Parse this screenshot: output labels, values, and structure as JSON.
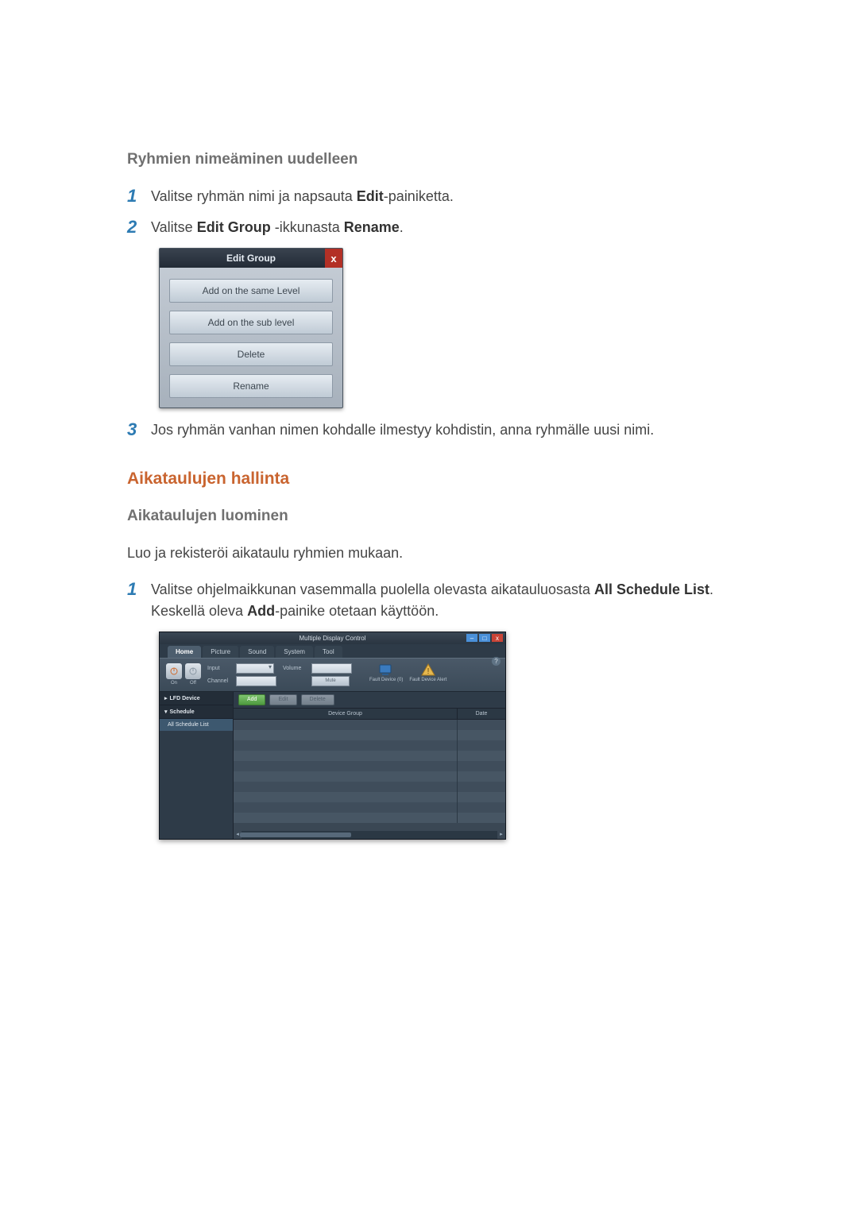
{
  "sec1": {
    "heading": "Ryhmien nimeäminen uudelleen",
    "step1_pre": "Valitse ryhmän nimi ja napsauta ",
    "step1_b": "Edit",
    "step1_post": "-painiketta.",
    "step2_pre": "Valitse ",
    "step2_b1": "Edit Group",
    "step2_mid": " -ikkunasta ",
    "step2_b2": "Rename",
    "step2_post": ".",
    "step3": "Jos ryhmän vanhan nimen kohdalle ilmestyy kohdistin, anna ryhmälle uusi nimi."
  },
  "dialog": {
    "title": "Edit Group",
    "close": "x",
    "btn1": "Add on the same Level",
    "btn2": "Add on the sub level",
    "btn3": "Delete",
    "btn4": "Rename"
  },
  "sec2": {
    "heading": "Aikataulujen hallinta",
    "sub": "Aikataulujen luominen",
    "intro": "Luo ja rekisteröi aikataulu ryhmien mukaan.",
    "step1_pre": "Valitse ohjelmaikkunan vasemmalla puolella olevasta aikatauluosasta ",
    "step1_b1": "All Schedule List",
    "step1_mid": ". Keskellä oleva ",
    "step1_b2": "Add",
    "step1_post": "-painike otetaan käyttöön."
  },
  "mdc": {
    "title": "Multiple Display Control",
    "tabs": {
      "home": "Home",
      "picture": "Picture",
      "sound": "Sound",
      "system": "System",
      "tool": "Tool"
    },
    "ribbon": {
      "on": "On",
      "off": "Off",
      "input": "Input",
      "channel": "Channel",
      "volume": "Volume",
      "mute": "Mute",
      "fault0": "Fault Device (0)",
      "alert": "Fault Device Alert"
    },
    "toolbar": {
      "add": "Add",
      "edit": "Edit",
      "delete": "Delete"
    },
    "side": {
      "lfd": "LFD Device",
      "schedule": "Schedule",
      "all": "All Schedule List"
    },
    "grid": {
      "group": "Device Group",
      "date": "Date"
    },
    "help": "?",
    "close": "x",
    "min": "–",
    "max": "□"
  },
  "nums": {
    "n1": "1",
    "n2": "2",
    "n3": "3"
  }
}
